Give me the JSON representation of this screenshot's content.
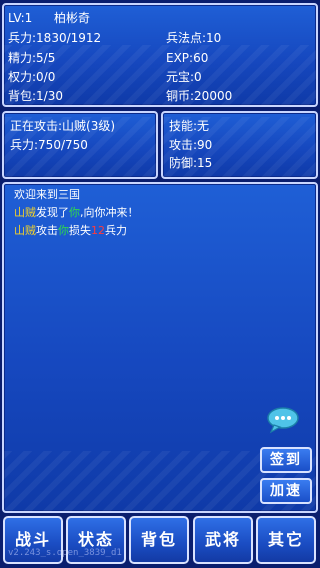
{
  "status": {
    "level": "LV:1",
    "name": "柏彬奇",
    "troops": "兵力:1830/1912",
    "energy": "精力:5/5",
    "power": "权力:0/0",
    "bag": "背包:1/30",
    "tactic_points": "兵法点:10",
    "exp": "EXP:60",
    "ingots": "元宝:0",
    "copper": "铜币:20000"
  },
  "battle": {
    "attacking": "正在攻击:山贼(3级)",
    "enemy_troops": "兵力:750/750"
  },
  "stats": {
    "skill": "技能:无",
    "attack": "攻击:90",
    "defense": "防御:15"
  },
  "log": {
    "welcome": "欢迎来到三国",
    "line2": {
      "enemy": "山贼",
      "mid": "发现了",
      "you": "你",
      "rest": ",向你冲来！"
    },
    "line3": {
      "enemy": "山贼",
      "mid": "攻击",
      "you": "你",
      "mid2": "损失",
      "amount": "12",
      "rest": "兵力"
    }
  },
  "side_buttons": {
    "checkin": "签到",
    "speed": "加速"
  },
  "tabs": [
    "战斗",
    "状态",
    "背包",
    "武将",
    "其它"
  ],
  "version": "v2.243_s.open_3839_d1",
  "colors": {
    "panel": "#1a4fc8",
    "border": "#c9d6ff",
    "enemy": "#f2d12a",
    "you": "#2fdc4a",
    "damage": "#ff3b3b"
  },
  "icons": {
    "chat": "chat-bubble-icon"
  }
}
